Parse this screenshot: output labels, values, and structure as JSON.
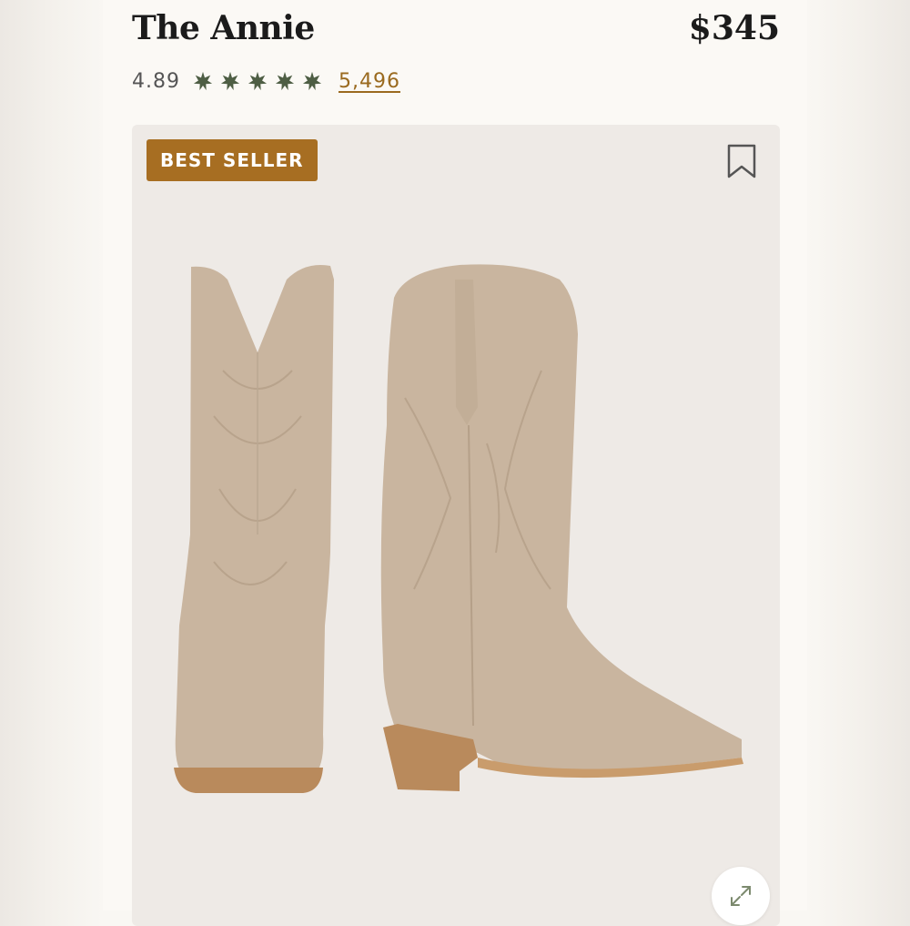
{
  "product": {
    "title": "The Annie",
    "price": "$345",
    "rating": "4.89",
    "stars": 5,
    "review_count": "5,496",
    "badge": "BEST SELLER"
  },
  "colors": {
    "star": "#4e5e44",
    "badge_bg": "#a76e22",
    "link": "#9a6a1f",
    "boot_suede": "#c9b59f",
    "boot_heel": "#b98a5c"
  },
  "icons": {
    "bookmark": "bookmark-icon",
    "zoom": "expand-icon",
    "star": "star-icon"
  }
}
